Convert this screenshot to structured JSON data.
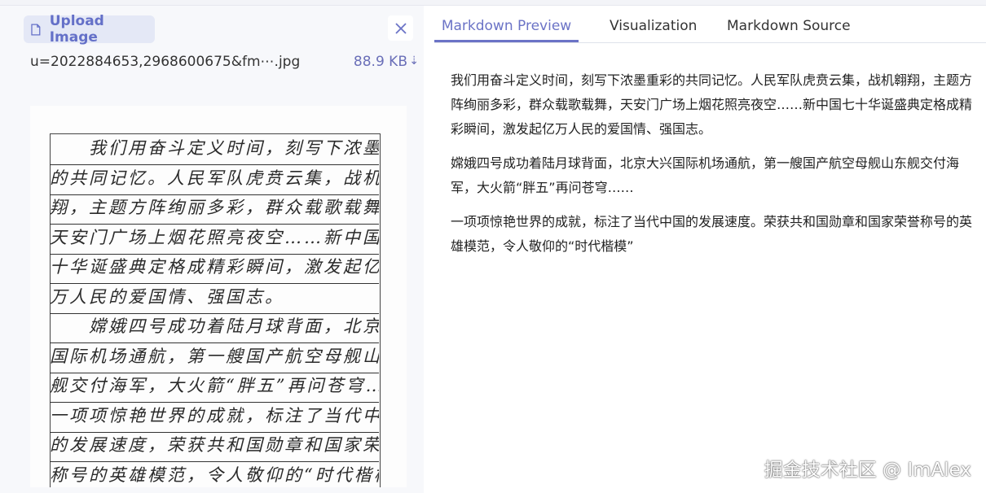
{
  "upload": {
    "label": "Upload Image",
    "icon": "file-icon"
  },
  "close": {
    "icon": "close-icon",
    "symbol": "✕"
  },
  "file": {
    "name": "u=2022884653,2968600675&fm⋯.jpg",
    "size": "88.9 KB",
    "download_symbol": "⇣"
  },
  "handwriting": {
    "lines": [
      "　　我们用奋斗定义时间，刻写下浓墨重彩",
      "的共同记忆。人民军队虎贲云集，战机翱",
      "翔，主题方阵绚丽多彩，群众载歌载舞，",
      "天安门广场上烟花照亮夜空……新中国七",
      "十华诞盛典定格成精彩瞬间，激发起亿",
      "万人民的爱国情、强国志。",
      "　　嫦娥四号成功着陆月球背面，北京大兴",
      "国际机场通航，第一艘国产航空母舰山东",
      "舰交付海军，大火箭“胖五”再问苍穹……",
      "一项项惊艳世界的成就，标注了当代中国",
      "的发展速度，荣获共和国勋章和国家荣誉",
      "称号的英雄模范，令人敬仰的“时代楷模”"
    ]
  },
  "tabs": [
    {
      "label": "Markdown Preview",
      "active": true
    },
    {
      "label": "Visualization",
      "active": false
    },
    {
      "label": "Markdown Source",
      "active": false
    }
  ],
  "preview": {
    "paragraphs": [
      "我们用奋斗定义时间，刻写下浓墨重彩的共同记忆。人民军队虎贲云集，战机翱翔，主题方阵绚丽多彩，群众载歌载舞，天安门广场上烟花照亮夜空……新中国七十华诞盛典定格成精彩瞬间，激发起亿万人民的爱国情、强国志。",
      "嫦娥四号成功着陆月球背面，北京大兴国际机场通航，第一艘国产航空母舰山东舰交付海军，大火箭“胖五”再问苍穹……",
      "一项项惊艳世界的成就，标注了当代中国的发展速度。荣获共和国勋章和国家荣誉称号的英雄模范，令人敬仰的“时代楷模”"
    ]
  },
  "watermark": "掘金技术社区 @ ImAlex",
  "colors": {
    "accent": "#6b73c6",
    "upload_bg": "#e4e8f6",
    "panel_bg": "#f7f8fb"
  }
}
